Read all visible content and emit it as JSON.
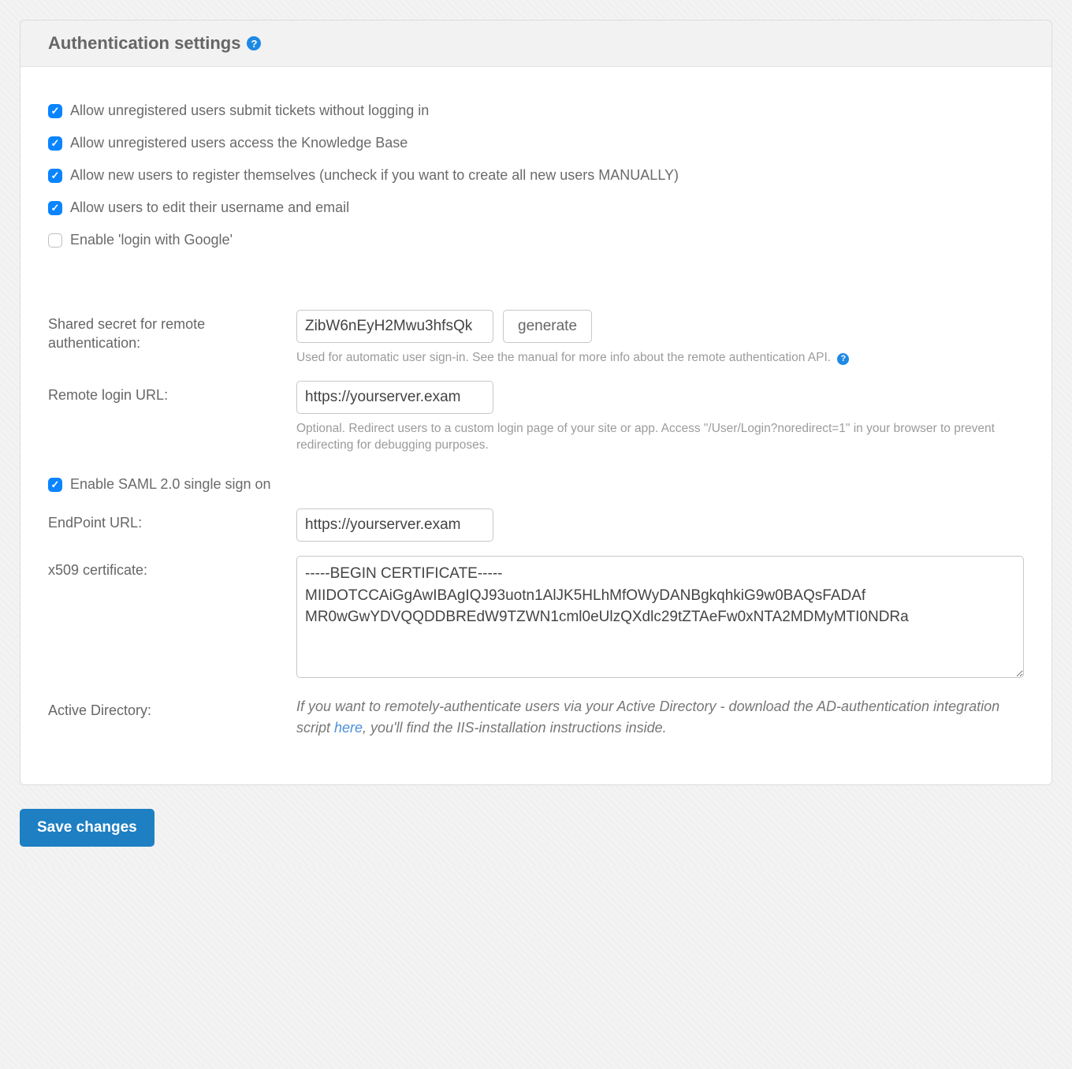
{
  "header": {
    "title": "Authentication settings"
  },
  "checkboxes": {
    "allow_unreg_tickets": {
      "label": "Allow unregistered users submit tickets without logging in",
      "checked": true
    },
    "allow_unreg_kb": {
      "label": "Allow unregistered users access the Knowledge Base",
      "checked": true
    },
    "allow_self_register": {
      "label": "Allow new users to register themselves (uncheck if you want to create all new users MANUALLY)",
      "checked": true
    },
    "allow_edit_username": {
      "label": "Allow users to edit their username and email",
      "checked": true
    },
    "enable_google_login": {
      "label": "Enable 'login with Google'",
      "checked": false
    },
    "enable_saml": {
      "label": "Enable SAML 2.0 single sign on",
      "checked": true
    }
  },
  "shared_secret": {
    "label": "Shared secret for remote authentication:",
    "value": "ZibW6nEyH2Mwu3hfsQk",
    "generate_label": "generate",
    "hint": "Used for automatic user sign-in. See the manual for more info about the remote authentication API."
  },
  "remote_login": {
    "label": "Remote login URL:",
    "value": "https://yourserver.exam",
    "hint": "Optional. Redirect users to a custom login page of your site or app. Access \"/User/Login?noredirect=1\" in your browser to prevent redirecting for debugging purposes."
  },
  "endpoint_url": {
    "label": "EndPoint URL:",
    "value": "https://yourserver.exam"
  },
  "x509": {
    "label": "x509 certificate:",
    "value": "-----BEGIN CERTIFICATE-----\nMIIDOTCCAiGgAwIBAgIQJ93uotn1AlJK5HLhMfOWyDANBgkqhkiG9w0BAQsFADAf\nMR0wGwYDVQQDDBREdW9TZWN1cml0eUlzQXdlc29tZTAeFw0xNTA2MDMyMTI0NDRa"
  },
  "active_directory": {
    "label": "Active Directory:",
    "text_before": "If you want to remotely-authenticate users via your Active Directory - download the AD-authentication integration script ",
    "link": "here",
    "text_after": ", you'll find the IIS-installation instructions inside."
  },
  "save_label": "Save changes"
}
